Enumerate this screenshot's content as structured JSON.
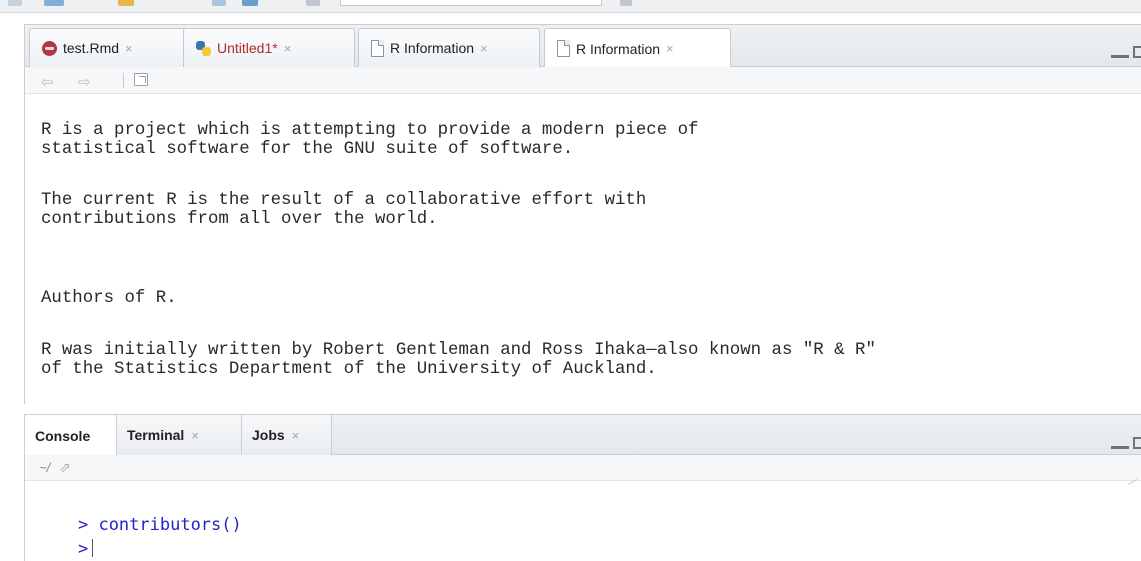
{
  "editor": {
    "tabs": [
      {
        "label": "test.Rmd",
        "icon": "rmarkdown-file-icon",
        "close": "×"
      },
      {
        "label": "Untitled1*",
        "icon": "python-file-icon",
        "close": "×"
      },
      {
        "label": "R Information",
        "icon": "document-icon",
        "close": "×"
      },
      {
        "label": "R Information",
        "icon": "document-icon",
        "close": "×",
        "active": true
      }
    ],
    "toolbar": {
      "back_glyph": "⇦",
      "forward_glyph": "⇨"
    },
    "content": [
      "R is a project which is attempting to provide a modern piece of\nstatistical software for the GNU suite of software.",
      "The current R is the result of a collaborative effort with\ncontributions from all over the world.",
      "Authors of R.",
      "R was initially written by Robert Gentleman and Ross Ihaka—also known as \"R & R\"\nof the Statistics Department of the University of Auckland."
    ]
  },
  "console": {
    "tabs": [
      {
        "label": "Console",
        "active": true
      },
      {
        "label": "Terminal",
        "close": "×"
      },
      {
        "label": "Jobs",
        "close": "×"
      }
    ],
    "path": "~/",
    "lines": [
      {
        "prompt": ">",
        "text": "contributors()"
      },
      {
        "prompt": ">",
        "text": ""
      }
    ]
  },
  "colors": {
    "modified_tab_text": "#b22a2a",
    "console_input": "#2323c8",
    "pane_border": "#c8ced4"
  }
}
